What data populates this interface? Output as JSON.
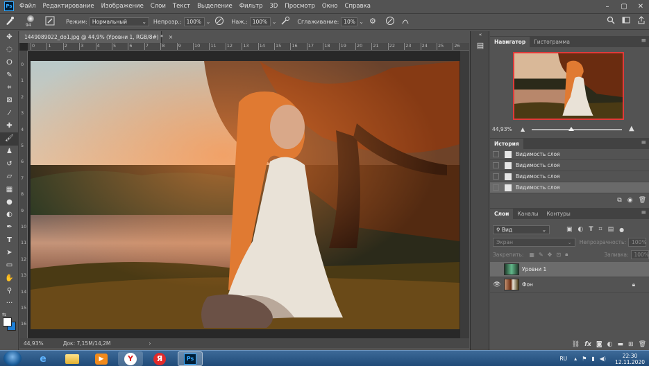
{
  "menubar": {
    "app_icon": "Ps",
    "items": [
      "Файл",
      "Редактирование",
      "Изображение",
      "Слои",
      "Текст",
      "Выделение",
      "Фильтр",
      "3D",
      "Просмотр",
      "Окно",
      "Справка"
    ],
    "window_controls": [
      "minimize-icon",
      "maximize-icon",
      "close-icon"
    ]
  },
  "options": {
    "brush_size": "94",
    "mode_label": "Режим:",
    "mode_value": "Нормальный",
    "opacity_label": "Непрозр.:",
    "opacity_value": "100%",
    "flow_label": "Наж.:",
    "flow_value": "100%",
    "smoothing_label": "Сглаживание:",
    "smoothing_value": "10%"
  },
  "tools": [
    "move-tool",
    "marquee-tool",
    "lasso-tool",
    "quick-select-tool",
    "crop-tool",
    "frame-tool",
    "eyedropper-tool",
    "healing-tool",
    "brush-tool",
    "stamp-tool",
    "history-brush-tool",
    "eraser-tool",
    "gradient-tool",
    "blur-tool",
    "dodge-tool",
    "pen-tool",
    "type-tool",
    "path-select-tool",
    "rectangle-tool",
    "hand-tool",
    "zoom-tool",
    "more-tools"
  ],
  "active_tool": "brush-tool",
  "document": {
    "tab_title": "1449089022_do1.jpg @ 44,9% (Уровни 1, RGB/8#) *",
    "close": "×",
    "ruler_top": [
      "0",
      "1",
      "2",
      "3",
      "4",
      "5",
      "6",
      "7",
      "8",
      "9",
      "10",
      "11",
      "12",
      "13",
      "14",
      "15",
      "16",
      "17",
      "18",
      "19",
      "20",
      "21",
      "22",
      "23",
      "24",
      "25",
      "26",
      "27"
    ],
    "ruler_left": [
      "0",
      "1",
      "2",
      "3",
      "4",
      "5",
      "6",
      "7",
      "8",
      "9",
      "10",
      "11",
      "12",
      "13",
      "14",
      "15",
      "16",
      "17"
    ]
  },
  "status": {
    "zoom": "44,93%",
    "doc_info": "Док: 7,15M/14,2M",
    "arrow": "›"
  },
  "navigator": {
    "tabs": [
      "Навигатор",
      "Гистограмма"
    ],
    "zoom": "44,93%",
    "zoom_level": 0.44
  },
  "history": {
    "tab": "История",
    "items": [
      "Видимость слоя",
      "Видимость слоя",
      "Видимость слоя",
      "Видимость слоя"
    ]
  },
  "layers": {
    "tabs": [
      "Слои",
      "Каналы",
      "Контуры"
    ],
    "filter_label": "Вид",
    "blend_mode": "Экран",
    "opacity_label": "Непрозрачность:",
    "opacity_value": "100%",
    "lock_label": "Закрепить:",
    "fill_label": "Заливка:",
    "fill_value": "100%",
    "list": [
      {
        "name": "Уровни 1",
        "visible": false,
        "selected": true,
        "locked": false
      },
      {
        "name": "Фон",
        "visible": true,
        "selected": false,
        "locked": true
      }
    ]
  },
  "taskbar": {
    "lang": "RU",
    "time": "22:30",
    "date": "12.11.2020",
    "apps": [
      "ie-icon",
      "explorer-icon",
      "media-player-icon",
      "yandex-icon",
      "yandex-browser-icon",
      "photoshop-icon"
    ]
  }
}
